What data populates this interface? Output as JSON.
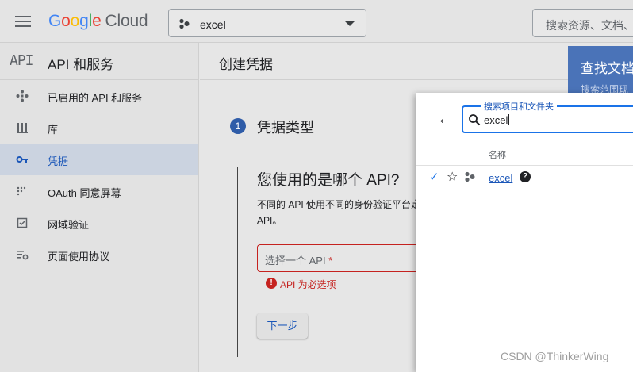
{
  "header": {
    "logo_letters": [
      "G",
      "o",
      "o",
      "g",
      "l",
      "e"
    ],
    "logo_suffix": "Cloud",
    "project": "excel",
    "search_placeholder": "搜索资源、文档、"
  },
  "sidebar": {
    "logo": "API",
    "title": "API 和服务",
    "items": [
      {
        "label": "已启用的 API 和服务",
        "icon": "diamond-api-icon"
      },
      {
        "label": "库",
        "icon": "library-icon"
      },
      {
        "label": "凭据",
        "icon": "key-icon",
        "active": true
      },
      {
        "label": "OAuth 同意屏幕",
        "icon": "oauth-dots-icon"
      },
      {
        "label": "网域验证",
        "icon": "checkbox-icon"
      },
      {
        "label": "页面使用协议",
        "icon": "settings-list-icon"
      }
    ]
  },
  "main": {
    "title": "创建凭据",
    "step_number": "1",
    "step_title": "凭据类型",
    "question": "您使用的是哪个 API?",
    "description": "不同的 API 使用不同的身份验证平台定 API。",
    "api_field_placeholder": "选择一个 API",
    "required_mark": "*",
    "error_icon": "!",
    "error_text": "API 为必选项",
    "next_button": "下一步"
  },
  "doc_panel": {
    "title": "查找文档",
    "subtitle": "搜索范围现"
  },
  "popup": {
    "search_label": "搜索项目和文件夹",
    "search_value": "excel",
    "column_header": "名称",
    "rows": [
      {
        "name": "excel",
        "selected": true,
        "help": "?"
      }
    ]
  },
  "watermark": "CSDN @ThinkerWing",
  "colors": {
    "accent": "#1a73e8",
    "error": "#c5221f",
    "active_nav_bg": "#cbd3e0"
  }
}
